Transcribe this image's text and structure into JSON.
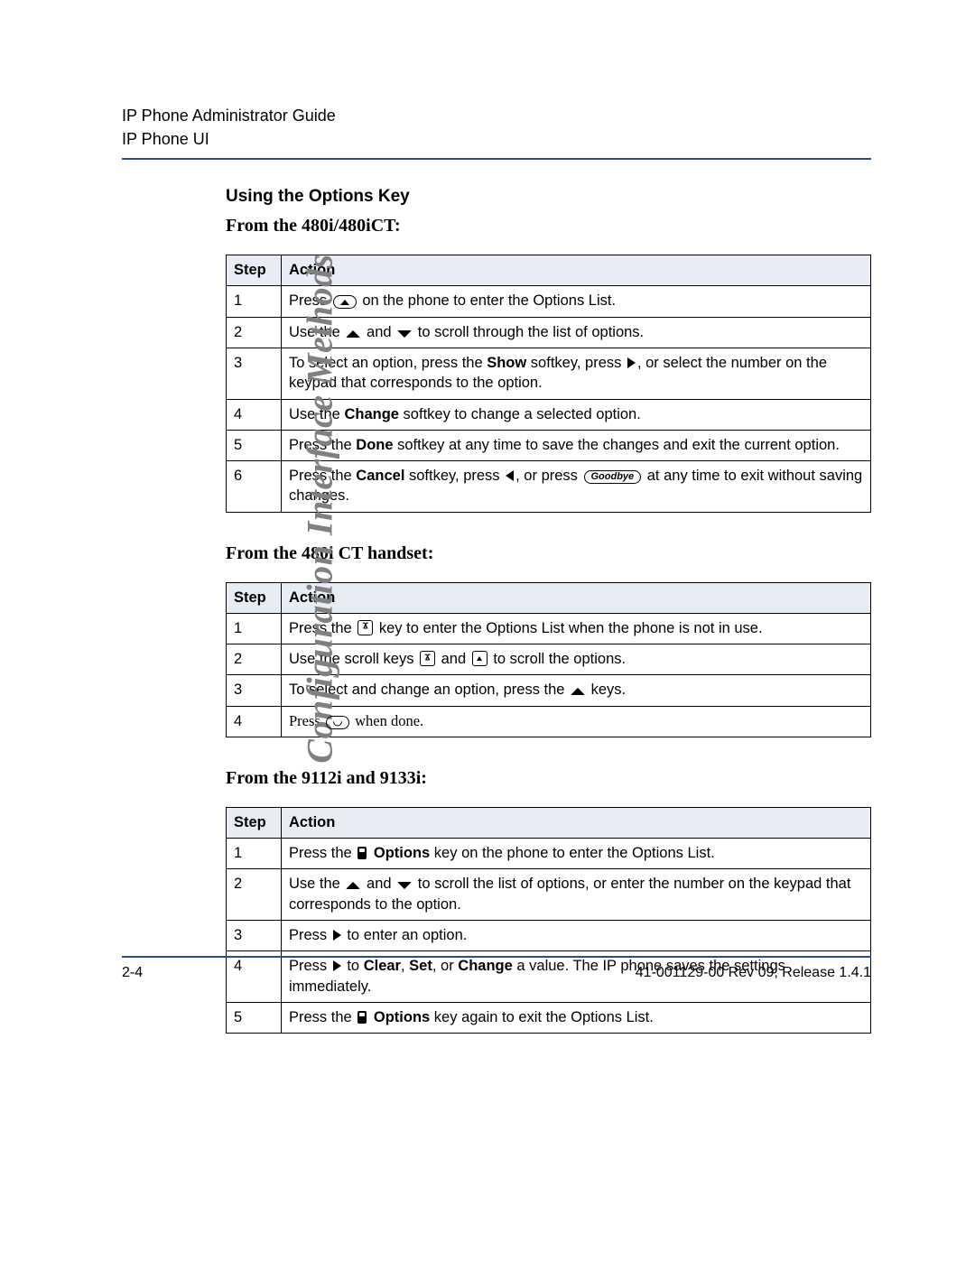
{
  "header": {
    "title": "IP Phone Administrator Guide",
    "subtitle": "IP Phone UI"
  },
  "side_label": "Configuration Interface Methods",
  "section_heading": "Using the Options Key",
  "tables": [
    {
      "title": "From the 480i/480iCT:",
      "col_step": "Step",
      "col_action": "Action",
      "rows": [
        {
          "n": "1",
          "parts": [
            {
              "t": "Press "
            },
            {
              "icon": "pill-peak"
            },
            {
              "t": " on the phone to enter the Options List."
            }
          ]
        },
        {
          "n": "2",
          "parts": [
            {
              "t": "Use the "
            },
            {
              "icon": "tri-up-curved"
            },
            {
              "t": " and "
            },
            {
              "icon": "tri-down-curved"
            },
            {
              "t": " to scroll through the list of options."
            }
          ]
        },
        {
          "n": "3",
          "parts": [
            {
              "t": "To select an option, press the "
            },
            {
              "b": "Show"
            },
            {
              "t": " softkey, press "
            },
            {
              "icon": "tri-right"
            },
            {
              "t": ", or select the number on the keypad that corresponds to the option."
            }
          ]
        },
        {
          "n": "4",
          "parts": [
            {
              "t": "Use the "
            },
            {
              "b": "Change"
            },
            {
              "t": " softkey to change a selected option."
            }
          ]
        },
        {
          "n": "5",
          "parts": [
            {
              "t": "Press the "
            },
            {
              "b": "Done"
            },
            {
              "t": " softkey at any time to save the changes and exit the current option."
            }
          ]
        },
        {
          "n": "6",
          "parts": [
            {
              "t": "Press the "
            },
            {
              "b": "Cancel"
            },
            {
              "t": " softkey, press "
            },
            {
              "icon": "tri-left"
            },
            {
              "t": ", or press "
            },
            {
              "pill": "Goodbye"
            },
            {
              "t": " at any time to exit without saving changes."
            }
          ]
        }
      ]
    },
    {
      "title": "From the 480i CT handset:",
      "col_step": "Step",
      "col_action": "Action",
      "rows": [
        {
          "n": "1",
          "parts": [
            {
              "t": "Press the "
            },
            {
              "icon": "keycap-y"
            },
            {
              "t": " key to enter the Options List when the phone is not in use."
            }
          ]
        },
        {
          "n": "2",
          "parts": [
            {
              "t": "Use the scroll keys "
            },
            {
              "icon": "keycap-y"
            },
            {
              "t": " and "
            },
            {
              "icon": "keycap-up"
            },
            {
              "t": " to scroll the options."
            }
          ]
        },
        {
          "n": "3",
          "parts": [
            {
              "t": "To select and change an option, press the "
            },
            {
              "icon": "tri-up-curved"
            },
            {
              "t": " keys."
            }
          ]
        },
        {
          "n": "4",
          "serif": true,
          "parts": [
            {
              "t": "Press "
            },
            {
              "icon": "pill-arc"
            },
            {
              "t": " when done."
            }
          ]
        }
      ]
    },
    {
      "title": "From the 9112i and 9133i:",
      "col_step": "Step",
      "col_action": "Action",
      "rows": [
        {
          "n": "1",
          "parts": [
            {
              "t": "Press the  "
            },
            {
              "icon": "phone"
            },
            {
              "t": " "
            },
            {
              "b": "Options"
            },
            {
              "t": " key on the phone to enter the Options List."
            }
          ]
        },
        {
          "n": "2",
          "parts": [
            {
              "t": "Use the "
            },
            {
              "icon": "tri-up-curved"
            },
            {
              "t": " and "
            },
            {
              "icon": "tri-down-curved"
            },
            {
              "t": " to scroll the list of options, or enter the number on the keypad that corresponds to the option."
            }
          ]
        },
        {
          "n": "3",
          "parts": [
            {
              "t": "Press "
            },
            {
              "icon": "tri-right"
            },
            {
              "t": " to enter an option."
            }
          ]
        },
        {
          "n": "4",
          "parts": [
            {
              "t": "Press "
            },
            {
              "icon": "tri-right"
            },
            {
              "t": " to "
            },
            {
              "b": "Clear"
            },
            {
              "t": ", "
            },
            {
              "b": "Set"
            },
            {
              "t": ", or "
            },
            {
              "b": "Change"
            },
            {
              "t": " a value. The IP phone saves the settings immediately."
            }
          ]
        },
        {
          "n": "5",
          "parts": [
            {
              "t": "Press the  "
            },
            {
              "icon": "phone"
            },
            {
              "t": " "
            },
            {
              "b": "Options"
            },
            {
              "t": " key again to exit the Options List."
            }
          ]
        }
      ]
    }
  ],
  "footer": {
    "page": "2-4",
    "release": "41-001129-00 Rev 09, Release 1.4.1"
  }
}
